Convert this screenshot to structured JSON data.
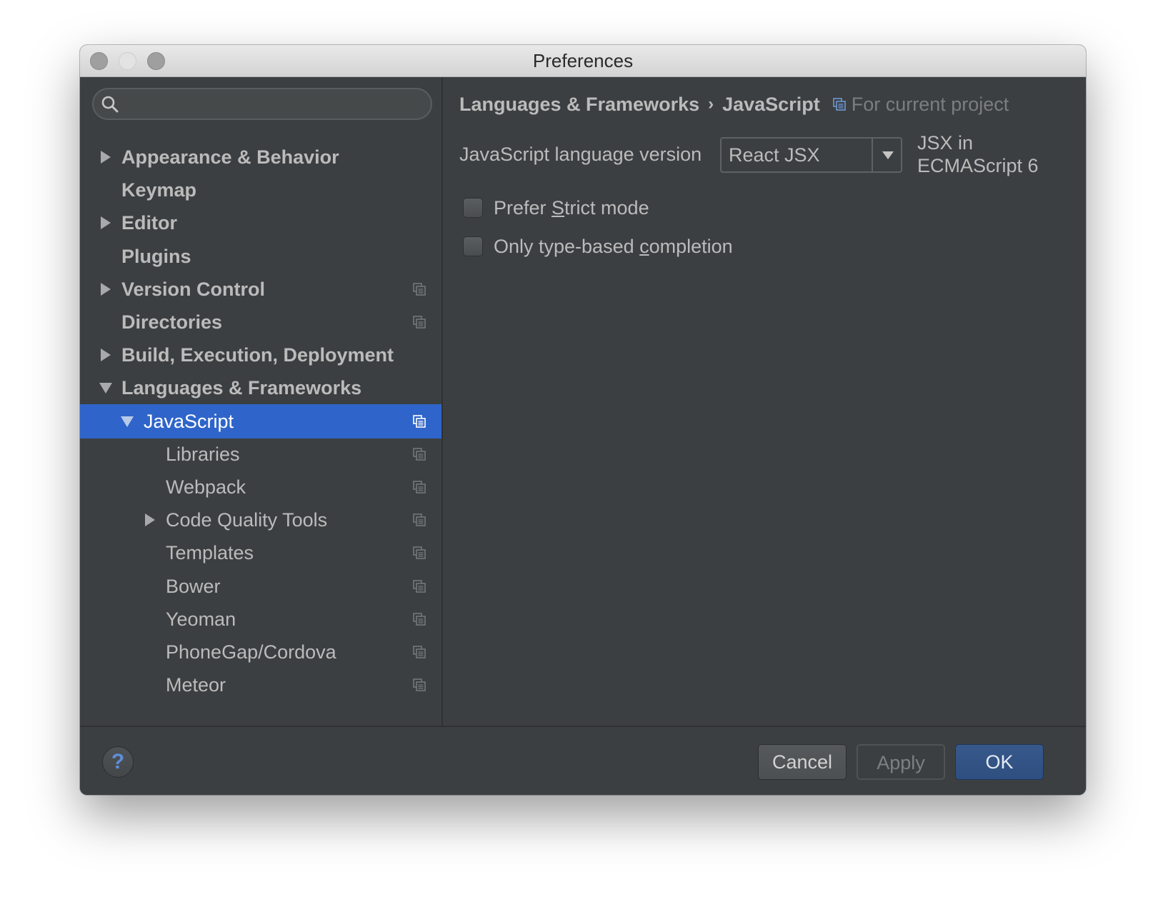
{
  "window": {
    "title": "Preferences"
  },
  "search": {
    "placeholder": "",
    "value": ""
  },
  "sidebar": {
    "items": [
      {
        "label": "Appearance & Behavior",
        "arrow": "right",
        "bold": true,
        "level": 0,
        "project_icon": false
      },
      {
        "label": "Keymap",
        "arrow": "none",
        "bold": true,
        "level": 0,
        "project_icon": false
      },
      {
        "label": "Editor",
        "arrow": "right",
        "bold": true,
        "level": 0,
        "project_icon": false
      },
      {
        "label": "Plugins",
        "arrow": "none",
        "bold": true,
        "level": 0,
        "project_icon": false
      },
      {
        "label": "Version Control",
        "arrow": "right",
        "bold": true,
        "level": 0,
        "project_icon": true
      },
      {
        "label": "Directories",
        "arrow": "none",
        "bold": true,
        "level": 0,
        "project_icon": true
      },
      {
        "label": "Build, Execution, Deployment",
        "arrow": "right",
        "bold": true,
        "level": 0,
        "project_icon": false
      },
      {
        "label": "Languages & Frameworks",
        "arrow": "down",
        "bold": true,
        "level": 0,
        "project_icon": false
      },
      {
        "label": "JavaScript",
        "arrow": "down",
        "bold": false,
        "level": 1,
        "project_icon": true,
        "selected": true
      },
      {
        "label": "Libraries",
        "arrow": "none",
        "bold": false,
        "level": 2,
        "project_icon": true
      },
      {
        "label": "Webpack",
        "arrow": "none",
        "bold": false,
        "level": 2,
        "project_icon": true
      },
      {
        "label": "Code Quality Tools",
        "arrow": "right",
        "bold": false,
        "level": 2,
        "project_icon": true
      },
      {
        "label": "Templates",
        "arrow": "none",
        "bold": false,
        "level": 2,
        "project_icon": true
      },
      {
        "label": "Bower",
        "arrow": "none",
        "bold": false,
        "level": 2,
        "project_icon": true
      },
      {
        "label": "Yeoman",
        "arrow": "none",
        "bold": false,
        "level": 2,
        "project_icon": true
      },
      {
        "label": "PhoneGap/Cordova",
        "arrow": "none",
        "bold": false,
        "level": 2,
        "project_icon": true
      },
      {
        "label": "Meteor",
        "arrow": "none",
        "bold": false,
        "level": 2,
        "project_icon": true
      }
    ]
  },
  "main": {
    "breadcrumb": {
      "parent": "Languages & Frameworks",
      "separator": "›",
      "current": "JavaScript",
      "scope": "For current project"
    },
    "language_version": {
      "label": "JavaScript language version",
      "value": "React JSX",
      "description": "JSX in ECMAScript 6"
    },
    "options": [
      {
        "label_before": "Prefer ",
        "mnemonic": "S",
        "label_after": "trict mode",
        "checked": false
      },
      {
        "label_before": "Only type-based ",
        "mnemonic": "c",
        "label_after": "ompletion",
        "checked": false
      }
    ]
  },
  "footer": {
    "help": "?",
    "cancel": "Cancel",
    "apply": "Apply",
    "ok": "OK"
  },
  "colors": {
    "panel_bg": "#3c3f41",
    "selection": "#2f65ca",
    "text": "#bbbbbb",
    "ok_button": "#2e4f80"
  }
}
